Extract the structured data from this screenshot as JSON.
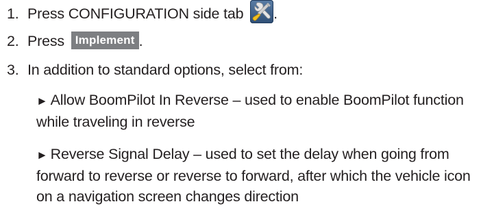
{
  "steps": [
    {
      "number": "1.",
      "text": "Press CONFIGURATION side tab",
      "suffix": ".",
      "icon": "configuration-tools-icon"
    },
    {
      "number": "2.",
      "text": "Press",
      "button_label": "Implement",
      "suffix": "."
    },
    {
      "number": "3.",
      "text": "In addition to standard options, select from:"
    }
  ],
  "bullets": [
    {
      "marker": "►",
      "text": "Allow BoomPilot In Reverse – used to enable BoomPilot function while traveling in reverse"
    },
    {
      "marker": "►",
      "text": "Reverse Signal Delay – used to set the delay when going from forward to reverse or reverse to forward, after which the vehicle icon on a navigation screen changes direction"
    }
  ],
  "colors": {
    "text": "#231f20",
    "button_background": "#7d7f82",
    "button_text": "#ffffff",
    "icon_background": "#3b5f8a"
  }
}
